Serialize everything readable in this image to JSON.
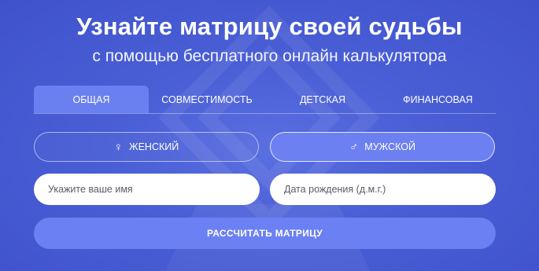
{
  "hero": {
    "title": "Узнайте матрицу своей судьбы",
    "subtitle": "с помощью бесплатного онлайн калькулятора"
  },
  "tabs": [
    {
      "label": "Общая"
    },
    {
      "label": "Совместимость"
    },
    {
      "label": "Детская"
    },
    {
      "label": "Финансовая"
    }
  ],
  "gender": {
    "female_label": "ЖЕНСКИЙ",
    "female_icon": "female-symbol-icon",
    "male_label": "МУЖСКОЙ",
    "male_icon": "male-symbol-icon",
    "selected": "male"
  },
  "form": {
    "name_placeholder": "Укажите ваше имя",
    "name_value": "",
    "date_placeholder": "Дата рождения (д.м.г.)",
    "date_value": ""
  },
  "submit_label": "РАССЧИТАТЬ МАТРИЦУ",
  "colors": {
    "background": "#4a5fd6",
    "accent": "#6b80f2",
    "text": "#ffffff"
  }
}
